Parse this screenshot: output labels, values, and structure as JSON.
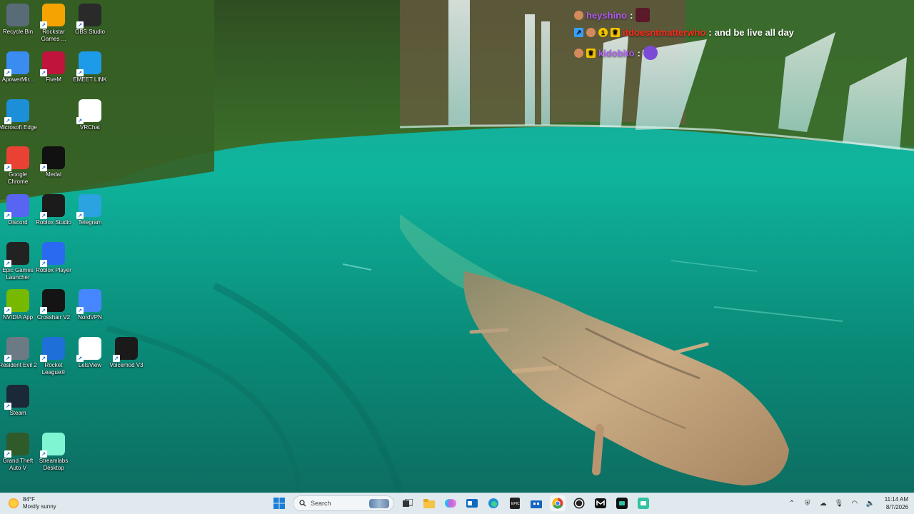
{
  "desktop_icons": [
    {
      "label": "Recycle Bin",
      "icon": "recycle-bin-icon",
      "color": "#5a6b78"
    },
    {
      "label": "Rockstar Games ...",
      "icon": "rockstar-games-icon",
      "color": "#f4a300"
    },
    {
      "label": "OBS Studio",
      "icon": "obs-studio-icon",
      "color": "#2a2a2a"
    },
    {
      "label": "ApowerMir...",
      "icon": "apowermirror-icon",
      "color": "#3b8cf0"
    },
    {
      "label": "FiveM",
      "icon": "fivem-icon",
      "color": "#c0143c"
    },
    {
      "label": "EMEET LINK",
      "icon": "emeet-link-icon",
      "color": "#1e9be8"
    },
    {
      "label": "Microsoft Edge",
      "icon": "edge-icon",
      "color": "#1d8fd8"
    },
    {
      "label": "VRChat",
      "icon": "vrchat-icon",
      "color": "#ffffff"
    },
    {
      "label": "Google Chrome",
      "icon": "chrome-icon",
      "color": "#e94235"
    },
    {
      "label": "Medal",
      "icon": "medal-icon",
      "color": "#111111"
    },
    {
      "label": "Discord",
      "icon": "discord-icon",
      "color": "#5865f2"
    },
    {
      "label": "Roblox Studio",
      "icon": "roblox-studio-icon",
      "color": "#1b1b1b"
    },
    {
      "label": "Telegram",
      "icon": "telegram-icon",
      "color": "#2aa3e0"
    },
    {
      "label": "Epic Games Launcher",
      "icon": "epic-games-icon",
      "color": "#222222"
    },
    {
      "label": "Roblox Player",
      "icon": "roblox-player-icon",
      "color": "#2a6af0"
    },
    {
      "label": "NVIDIA App",
      "icon": "nvidia-icon",
      "color": "#76b900"
    },
    {
      "label": "Crosshair V2",
      "icon": "crosshair-icon",
      "color": "#141414"
    },
    {
      "label": "NordVPN",
      "icon": "nordvpn-icon",
      "color": "#4687ff"
    },
    {
      "label": "Resident Evil 2",
      "icon": "resident-evil-icon",
      "color": "#6c7a86"
    },
    {
      "label": "Rocket League®",
      "icon": "rocket-league-icon",
      "color": "#1e6fd8"
    },
    {
      "label": "LetsView",
      "icon": "letsview-icon",
      "color": "#ffffff"
    },
    {
      "label": "Voicemod V3",
      "icon": "voicemod-icon",
      "color": "#1a1a1a"
    },
    {
      "label": "Steam",
      "icon": "steam-icon",
      "color": "#1b2838"
    },
    {
      "label": "Grand Theft Auto V",
      "icon": "gta-icon",
      "color": "#2f5a2a"
    },
    {
      "label": "Streamlabs Desktop",
      "icon": "streamlabs-icon",
      "color": "#80f5d2"
    }
  ],
  "chat": [
    {
      "user": "heyshino",
      "user_color": "#b05cf2",
      "message": ""
    },
    {
      "user": "itdoesntmatterwho",
      "user_color": "#ff2a1a",
      "message": "and be live all day"
    },
    {
      "user": "kidobito",
      "user_color": "#b05cf2",
      "message": ""
    }
  ],
  "taskbar": {
    "weather_temp": "84°F",
    "weather_desc": "Mostly sunny",
    "search_placeholder": "Search",
    "apps": [
      "start-icon",
      "task-view-icon",
      "file-explorer-icon",
      "copilot-icon",
      "outlook-icon",
      "edge-icon",
      "epic-games-icon",
      "microsoft-store-icon",
      "chrome-icon",
      "obs-studio-icon",
      "medal-icon",
      "streamlabs-icon",
      "streamlabs-alt-icon"
    ],
    "time": "11:14 AM",
    "date": "8/7/2026"
  }
}
